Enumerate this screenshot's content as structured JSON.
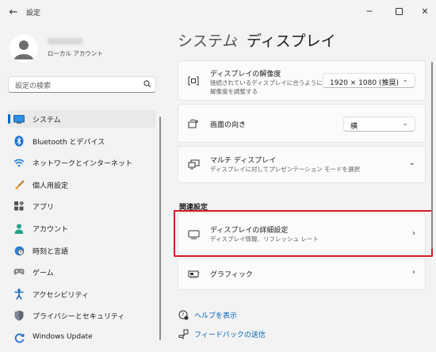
{
  "window": {
    "title": "設定"
  },
  "profile": {
    "account_type": "ローカル アカウント"
  },
  "search": {
    "placeholder": "設定の検索"
  },
  "nav": {
    "items": [
      {
        "label": "システム",
        "icon": "system-icon",
        "selected": true
      },
      {
        "label": "Bluetooth とデバイス",
        "icon": "bluetooth-icon"
      },
      {
        "label": "ネットワークとインターネット",
        "icon": "wifi-icon"
      },
      {
        "label": "個人用設定",
        "icon": "brush-icon"
      },
      {
        "label": "アプリ",
        "icon": "apps-icon"
      },
      {
        "label": "アカウント",
        "icon": "person-icon"
      },
      {
        "label": "時刻と言語",
        "icon": "clock-globe-icon"
      },
      {
        "label": "ゲーム",
        "icon": "gamepad-icon"
      },
      {
        "label": "アクセシビリティ",
        "icon": "accessibility-icon"
      },
      {
        "label": "プライバシーとセキュリティ",
        "icon": "shield-icon"
      },
      {
        "label": "Windows Update",
        "icon": "update-icon"
      }
    ]
  },
  "page": {
    "parent": "システム",
    "separator": "›",
    "current": "ディスプレイ"
  },
  "cards": {
    "resolution": {
      "title": "ディスプレイの解像度",
      "desc1": "接続されているディスプレイに合うように",
      "desc2": "解像度を調整する",
      "value": "1920 × 1080 (推奨)"
    },
    "orientation": {
      "title": "画面の向き",
      "value": "横"
    },
    "multi": {
      "title": "マルチ ディスプレイ",
      "desc": "ディスプレイに対してプレゼンテーション モードを選択"
    }
  },
  "related": {
    "title": "関連設定",
    "advanced": {
      "title": "ディスプレイの詳細設定",
      "desc": "ディスプレイ情報、リフレッシュ レート"
    },
    "graphics": {
      "title": "グラフィック"
    }
  },
  "links": {
    "help": "ヘルプを表示",
    "feedback": "フィードバックの送信"
  },
  "colors": {
    "accent": "#0067c0",
    "highlight_border": "#d41c23",
    "link": "#0064b8"
  }
}
